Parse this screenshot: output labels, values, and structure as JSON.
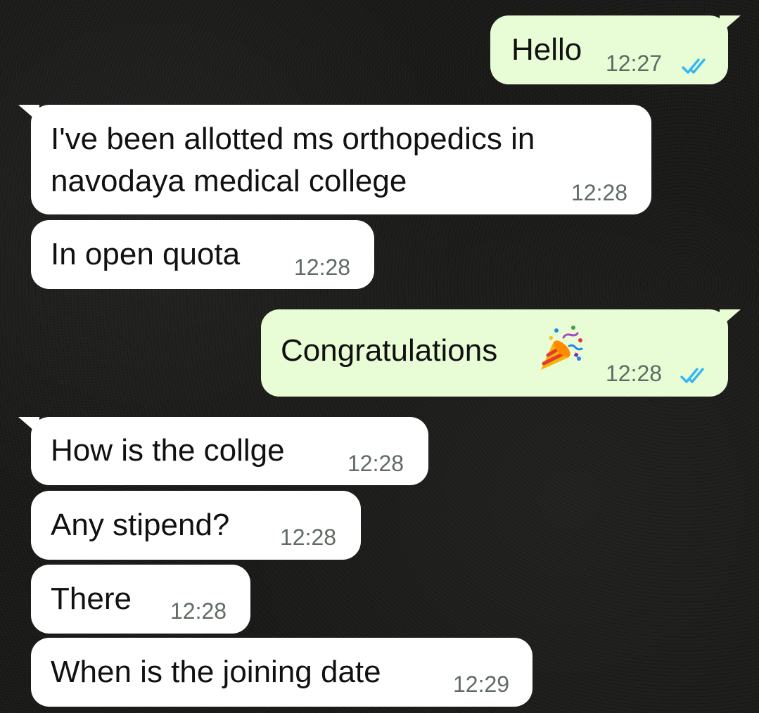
{
  "messages": [
    {
      "direction": "outgoing",
      "text": "Hello",
      "time": "12:27",
      "status_icon": "double-check-read-icon"
    },
    {
      "direction": "incoming",
      "text_lines": [
        "I've been allotted ms orthopedics in",
        "navodaya medical college"
      ],
      "time": "12:28"
    },
    {
      "direction": "incoming",
      "text": "In open quota",
      "time": "12:28"
    },
    {
      "direction": "outgoing",
      "text": "Congratulations",
      "emoji": "party-popper-icon",
      "time": "12:28",
      "status_icon": "double-check-read-icon"
    },
    {
      "direction": "incoming",
      "text": "How is the collge",
      "time": "12:28"
    },
    {
      "direction": "incoming",
      "text": "Any stipend?",
      "time": "12:28"
    },
    {
      "direction": "incoming",
      "text": "There",
      "time": "12:28"
    },
    {
      "direction": "incoming",
      "text": "When is the joining date",
      "time": "12:29"
    }
  ],
  "colors": {
    "background": "#1b1c1a",
    "incoming_bubble": "#ffffff",
    "outgoing_bubble": "#e8fcd6",
    "timestamp": "#5f6b63",
    "read_ticks": "#34b7f1"
  }
}
